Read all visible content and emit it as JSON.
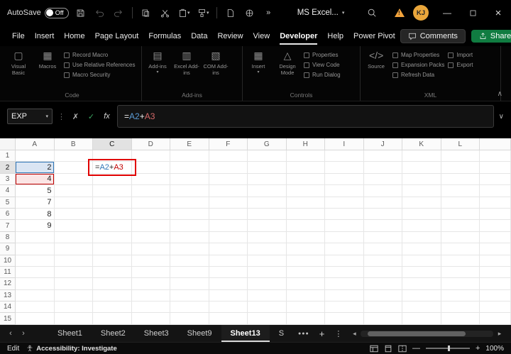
{
  "colors": {
    "share_green": "#107C41",
    "accent_underline": "#E8E8E8",
    "ref_blue": "#2E75B6",
    "ref_red": "#C00000",
    "annotation_red": "#E00000",
    "warning_orange": "#F2A33C",
    "avatar_bg": "#E9A63B"
  },
  "titlebar": {
    "autosave_label": "AutoSave",
    "autosave_state": "Off",
    "title": "MS Excel...",
    "overflow_glyph": "»",
    "user_initials": "KJ",
    "icons": [
      "save-icon",
      "undo-icon",
      "redo-icon",
      "copy-icon",
      "cut-icon",
      "paste-icon",
      "format-painter-icon",
      "document-icon",
      "globe-icon",
      "search-icon",
      "warning-icon",
      "minimize-icon",
      "maximize-icon",
      "close-icon"
    ]
  },
  "menubar": {
    "tabs": [
      {
        "label": "File"
      },
      {
        "label": "Insert"
      },
      {
        "label": "Home"
      },
      {
        "label": "Page Layout"
      },
      {
        "label": "Formulas"
      },
      {
        "label": "Data"
      },
      {
        "label": "Review"
      },
      {
        "label": "View"
      },
      {
        "label": "Developer",
        "active": true
      },
      {
        "label": "Help"
      },
      {
        "label": "Power Pivot"
      }
    ],
    "comments_label": "Comments",
    "share_label": "Share"
  },
  "ribbon": {
    "collapse_glyph": "∧",
    "groups": [
      {
        "label": "Code",
        "big": [
          {
            "label": "Visual Basic",
            "glyph": "▢"
          },
          {
            "label": "Macros",
            "glyph": "▦"
          }
        ],
        "small": [
          {
            "label": "Record Macro"
          },
          {
            "label": "Use Relative References"
          },
          {
            "label": "Macro Security"
          }
        ]
      },
      {
        "label": "Add-ins",
        "big": [
          {
            "label": "Add-ins",
            "glyph": "▤",
            "chevron": true
          },
          {
            "label": "Excel Add-ins",
            "glyph": "▥"
          },
          {
            "label": "COM Add-ins",
            "glyph": "▧"
          }
        ],
        "small": []
      },
      {
        "label": "Controls",
        "big": [
          {
            "label": "Insert",
            "glyph": "▦",
            "chevron": true
          },
          {
            "label": "Design Mode",
            "glyph": "△"
          }
        ],
        "small": [
          {
            "label": "Properties"
          },
          {
            "label": "View Code"
          },
          {
            "label": "Run Dialog"
          }
        ]
      },
      {
        "label": "XML",
        "big": [
          {
            "label": "Source",
            "glyph": "</>"
          }
        ],
        "small": [
          {
            "label": "Map Properties"
          },
          {
            "label": "Expansion Packs"
          },
          {
            "label": "Refresh Data"
          }
        ],
        "small2": [
          {
            "label": "Import"
          },
          {
            "label": "Export"
          }
        ]
      }
    ]
  },
  "formula_bar": {
    "name_box_value": "EXP",
    "name_box_chevron": "▾",
    "separator_glyph": "⋮",
    "cancel_glyph": "✗",
    "enter_glyph": "✓",
    "fx_label": "fx",
    "expand_glyph": "∨",
    "formula_parts": [
      {
        "text": "=",
        "color": "default"
      },
      {
        "text": "A2",
        "color": "blue"
      },
      {
        "text": "+",
        "color": "default"
      },
      {
        "text": "A3",
        "color": "red"
      }
    ]
  },
  "grid": {
    "column_headers": [
      "A",
      "B",
      "C",
      "D",
      "E",
      "F",
      "G",
      "H",
      "I",
      "J",
      "K",
      "L"
    ],
    "visible_rows": 15,
    "highlight_column": "C",
    "highlight_row": 2,
    "cells": [
      {
        "ref": "A2",
        "col": "A",
        "row": 2,
        "value": "2",
        "highlight": "blue"
      },
      {
        "ref": "A3",
        "col": "A",
        "row": 3,
        "value": "4",
        "highlight": "red"
      },
      {
        "ref": "A4",
        "col": "A",
        "row": 4,
        "value": "5"
      },
      {
        "ref": "A5",
        "col": "A",
        "row": 5,
        "value": "7"
      },
      {
        "ref": "A6",
        "col": "A",
        "row": 6,
        "value": "8"
      },
      {
        "ref": "A7",
        "col": "A",
        "row": 7,
        "value": "9"
      }
    ],
    "editing_cell": {
      "ref": "C2",
      "col": "C",
      "row": 2
    }
  },
  "sheetbar": {
    "nav_left": "‹",
    "nav_right": "›",
    "tabs": [
      {
        "label": "Sheet1"
      },
      {
        "label": "Sheet2"
      },
      {
        "label": "Sheet3"
      },
      {
        "label": "Sheet9"
      },
      {
        "label": "Sheet13",
        "active": true
      },
      {
        "label": "S"
      }
    ],
    "more_glyph": "●●●",
    "add_glyph": "+",
    "menu_glyph": "⋮",
    "scroll_left": "◂",
    "scroll_right": "▸"
  },
  "statusbar": {
    "mode": "Edit",
    "accessibility": "Accessibility: Investigate",
    "zoom": "100%"
  }
}
